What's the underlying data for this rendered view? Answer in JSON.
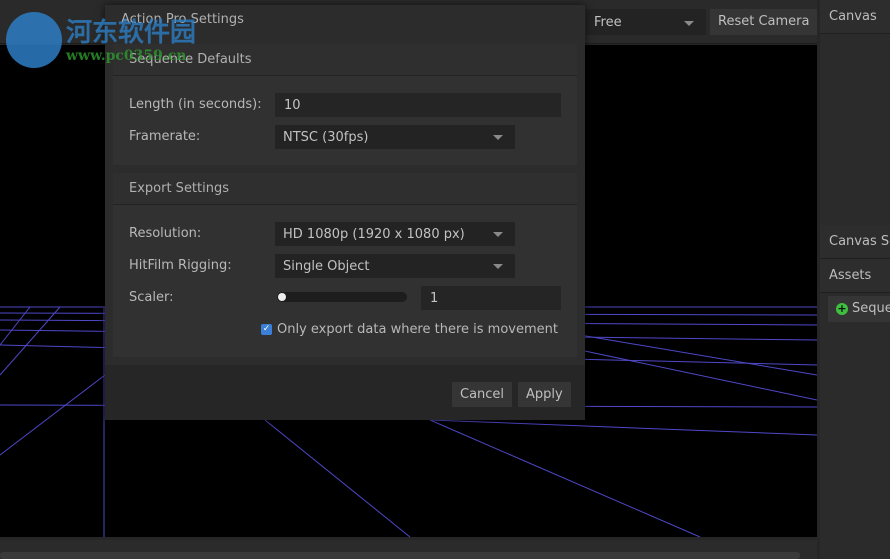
{
  "watermark": {
    "name": "河东软件园",
    "url": "www.pc0359.cn"
  },
  "toolbar": {
    "camera_mode": "Free",
    "reset_camera": "Reset Camera"
  },
  "right_panel": {
    "canvas": "Canvas",
    "canvas_scenes": "Canvas Sc",
    "assets": "Assets",
    "sequence_button": "Seque"
  },
  "dialog": {
    "title": "Action Pro Settings",
    "sequence_defaults": {
      "header": "Sequence Defaults",
      "length_label": "Length (in seconds):",
      "length_value": "10",
      "framerate_label": "Framerate:",
      "framerate_value": "NTSC (30fps)"
    },
    "export_settings": {
      "header": "Export Settings",
      "resolution_label": "Resolution:",
      "resolution_value": "HD 1080p (1920 x 1080 px)",
      "rigging_label": "HitFilm Rigging:",
      "rigging_value": "Single Object",
      "scaler_label": "Scaler:",
      "scaler_value": "1",
      "scaler_fraction": 0,
      "movement_checkbox_label": "Only export data where there is movement",
      "movement_checked": true
    },
    "cancel": "Cancel",
    "apply": "Apply"
  },
  "colors": {
    "grid": "#5a52d8",
    "accent_green": "#3fbf3f",
    "checkbox": "#3b7fd6"
  }
}
